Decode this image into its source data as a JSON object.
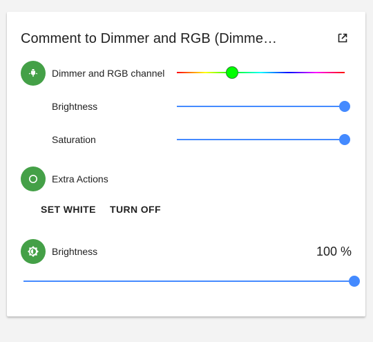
{
  "card": {
    "title": "Comment to Dimmer and RGB (Dimme…",
    "open_icon": "open-in-new-icon"
  },
  "rgb": {
    "icon": "lightbulb-icon",
    "label": "Dimmer and RGB channel",
    "hue_level": 0.33
  },
  "brightness_row": {
    "label": "Brightness",
    "level": 1.0
  },
  "saturation_row": {
    "label": "Saturation",
    "level": 1.0
  },
  "extra_actions": {
    "icon": "circle-outline-icon",
    "label": "Extra Actions",
    "set_white_label": "SET WHITE",
    "turn_off_label": "TURN OFF"
  },
  "brightness_entity": {
    "icon": "brightness-icon",
    "label": "Brightness",
    "value_text": "100 %",
    "level": 1.0
  },
  "colors": {
    "accent": "#448aff",
    "badge": "#44a047"
  }
}
